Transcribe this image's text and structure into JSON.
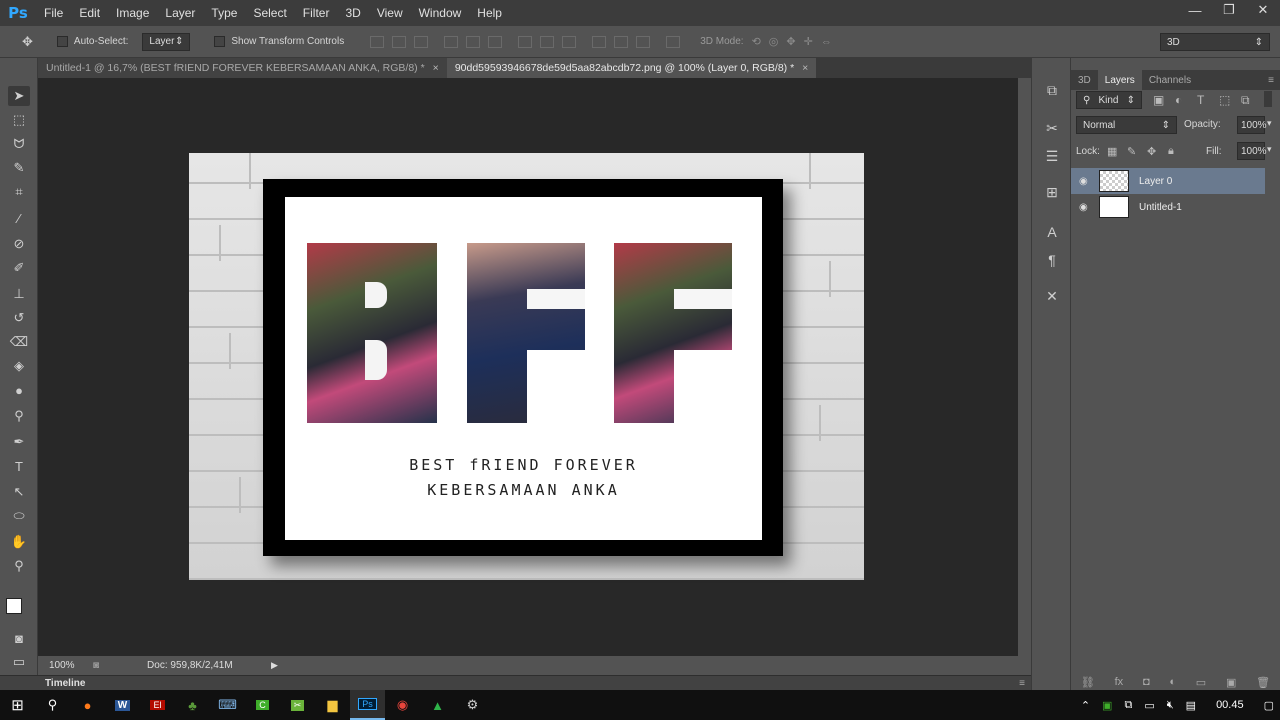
{
  "menubar": {
    "logo": "Ps",
    "items": [
      "File",
      "Edit",
      "Image",
      "Layer",
      "Type",
      "Select",
      "Filter",
      "3D",
      "View",
      "Window",
      "Help"
    ]
  },
  "window_controls": {
    "minimize": "—",
    "maximize": "❐",
    "close": "✕"
  },
  "options_bar": {
    "auto_select_label": "Auto-Select:",
    "auto_select_value": "Layer",
    "show_transform_label": "Show Transform Controls",
    "mode_3d_label": "3D Mode:",
    "workspace_value": "3D"
  },
  "tabs": [
    {
      "label": "Untitled-1 @ 16,7% (BEST fRIEND FOREVER KEBERSAMAAN ANKA, RGB/8) *",
      "close": "×"
    },
    {
      "label": "90dd59593946678de59d5aa82abcdb72.png @ 100% (Layer 0, RGB/8) *",
      "close": "×"
    }
  ],
  "document": {
    "letters": [
      "B",
      "F",
      "F"
    ],
    "caption_line1": "BEST fRIEND FOREVER",
    "caption_line2": "KEBERSAMAAN ANKA"
  },
  "statusbar": {
    "zoom": "100%",
    "doc_info": "Doc: 959,8K/2,41M"
  },
  "timeline": {
    "label": "Timeline"
  },
  "panel": {
    "tabs": [
      "3D",
      "Layers",
      "Channels"
    ],
    "filter_kind": "Kind",
    "blend_mode": "Normal",
    "opacity_label": "Opacity:",
    "opacity_value": "100%",
    "lock_label": "Lock:",
    "fill_label": "Fill:",
    "fill_value": "100%",
    "layers": [
      {
        "name": "Layer 0"
      },
      {
        "name": "Untitled-1"
      }
    ]
  },
  "taskbar": {
    "clock": "00.45"
  }
}
